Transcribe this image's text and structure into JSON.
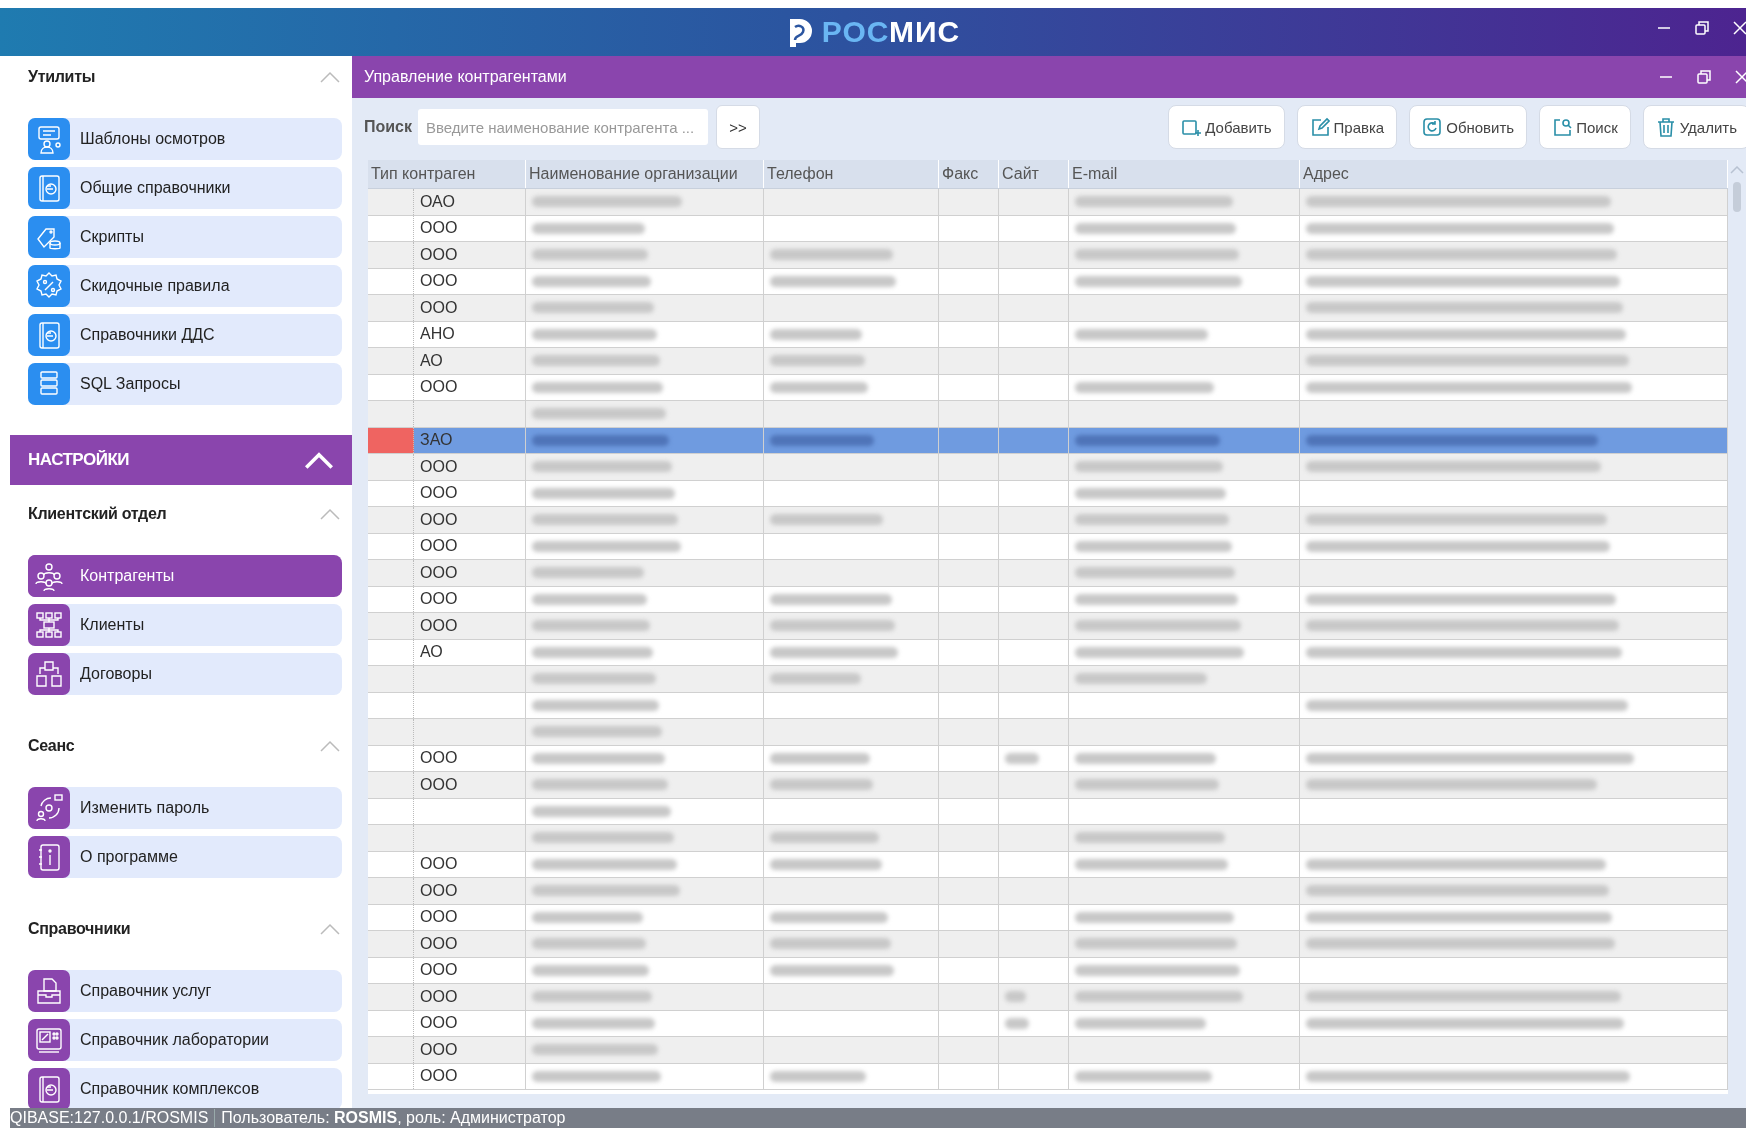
{
  "titlebar": {
    "logo_prefix": "РОС",
    "logo_suffix": "МИС"
  },
  "sidebar": {
    "sections": [
      {
        "kind": "group",
        "title": "Утилиты",
        "expanded": true,
        "color": "#2b8ef0",
        "items": [
          {
            "label": "Шаблоны осмотров",
            "selected": false
          },
          {
            "label": "Общие справочники",
            "selected": false
          },
          {
            "label": "Скрипты",
            "selected": false
          },
          {
            "label": "Скидочные правила",
            "selected": false
          },
          {
            "label": "Справочники ДДС",
            "selected": false
          },
          {
            "label": "SQL Запросы",
            "selected": false
          }
        ]
      },
      {
        "kind": "category",
        "title": "НАСТРОЙКИ",
        "expanded": true
      },
      {
        "kind": "group",
        "title": "Клиентский отдел",
        "expanded": true,
        "color": "#8a45ad",
        "items": [
          {
            "label": "Контрагенты",
            "selected": true
          },
          {
            "label": "Клиенты",
            "selected": false
          },
          {
            "label": "Договоры",
            "selected": false
          }
        ]
      },
      {
        "kind": "group",
        "title": "Сеанс",
        "expanded": true,
        "color": "#8a45ad",
        "items": [
          {
            "label": "Изменить пароль",
            "selected": false
          },
          {
            "label": "О программе",
            "selected": false
          }
        ]
      },
      {
        "kind": "group",
        "title": "Справочники",
        "expanded": true,
        "color": "#8a45ad",
        "items": [
          {
            "label": "Справочник услуг",
            "selected": false
          },
          {
            "label": "Справочник лаборатории",
            "selected": false
          },
          {
            "label": "Справочник комплексов",
            "selected": false
          }
        ]
      }
    ]
  },
  "panel": {
    "title": "Управление контрагентами",
    "search": {
      "label": "Поиск",
      "placeholder": "Введите наименование контрагента ...",
      "go": ">>"
    },
    "buttons": [
      "Добавить",
      "Правка",
      "Обновить",
      "Поиск",
      "Удалить"
    ],
    "table": {
      "columns": [
        "Тип контраген",
        "Наименование организации",
        "Телефон",
        "Факс",
        "Сайт",
        "E-mail",
        "Адрес"
      ],
      "rows": [
        {
          "type": "ОАО",
          "selected": false,
          "blurred": [
            true,
            false,
            false,
            false,
            true,
            true
          ]
        },
        {
          "type": "ООО",
          "selected": false,
          "blurred": [
            true,
            false,
            false,
            false,
            true,
            true
          ]
        },
        {
          "type": "ООО",
          "selected": false,
          "blurred": [
            true,
            true,
            false,
            false,
            true,
            true
          ]
        },
        {
          "type": "ООО",
          "selected": false,
          "blurred": [
            true,
            true,
            false,
            false,
            true,
            true
          ]
        },
        {
          "type": "ООО",
          "selected": false,
          "blurred": [
            true,
            false,
            false,
            false,
            false,
            true
          ]
        },
        {
          "type": "АНО",
          "selected": false,
          "blurred": [
            true,
            true,
            false,
            false,
            true,
            true
          ]
        },
        {
          "type": "АО",
          "selected": false,
          "blurred": [
            true,
            true,
            false,
            false,
            false,
            true
          ]
        },
        {
          "type": "ООО",
          "selected": false,
          "blurred": [
            true,
            true,
            false,
            false,
            true,
            true
          ]
        },
        {
          "selected": false,
          "blurred": [
            true,
            false,
            false,
            false,
            false,
            false
          ]
        },
        {
          "type": "ЗАО",
          "selected": true,
          "blurred": [
            true,
            true,
            false,
            false,
            true,
            true
          ]
        },
        {
          "type": "ООО",
          "selected": false,
          "blurred": [
            true,
            false,
            false,
            false,
            true,
            true
          ]
        },
        {
          "type": "ООО",
          "selected": false,
          "blurred": [
            true,
            false,
            false,
            false,
            true,
            false
          ]
        },
        {
          "type": "ООО",
          "selected": false,
          "blurred": [
            true,
            true,
            false,
            false,
            true,
            true
          ]
        },
        {
          "type": "ООО",
          "selected": false,
          "blurred": [
            true,
            false,
            false,
            false,
            true,
            true
          ]
        },
        {
          "type": "ООО",
          "selected": false,
          "blurred": [
            true,
            false,
            false,
            false,
            true,
            false
          ]
        },
        {
          "type": "ООО",
          "selected": false,
          "blurred": [
            true,
            true,
            false,
            false,
            true,
            true
          ]
        },
        {
          "type": "ООО",
          "selected": false,
          "blurred": [
            true,
            true,
            false,
            false,
            true,
            true
          ]
        },
        {
          "type": "АО",
          "selected": false,
          "blurred": [
            true,
            true,
            false,
            false,
            true,
            true
          ]
        },
        {
          "selected": false,
          "blurred": [
            true,
            true,
            false,
            false,
            true,
            false
          ]
        },
        {
          "selected": false,
          "blurred": [
            true,
            false,
            false,
            false,
            false,
            true
          ]
        },
        {
          "selected": false,
          "blurred": [
            true,
            false,
            false,
            false,
            false,
            false
          ]
        },
        {
          "type": "ООО",
          "selected": false,
          "blurred": [
            true,
            true,
            false,
            true,
            true,
            true
          ]
        },
        {
          "type": "ООО",
          "selected": false,
          "blurred": [
            true,
            true,
            false,
            false,
            true,
            true
          ]
        },
        {
          "selected": false,
          "blurred": [
            true,
            false,
            false,
            false,
            false,
            false
          ]
        },
        {
          "selected": false,
          "blurred": [
            true,
            true,
            false,
            false,
            true,
            false
          ]
        },
        {
          "type": "ООО",
          "selected": false,
          "blurred": [
            true,
            true,
            false,
            false,
            true,
            true
          ]
        },
        {
          "type": "ООО",
          "selected": false,
          "blurred": [
            true,
            false,
            false,
            false,
            false,
            true
          ]
        },
        {
          "type": "ООО",
          "selected": false,
          "blurred": [
            true,
            true,
            false,
            false,
            true,
            true
          ]
        },
        {
          "type": "ООО",
          "selected": false,
          "blurred": [
            true,
            true,
            false,
            false,
            true,
            true
          ]
        },
        {
          "type": "ООО",
          "selected": false,
          "blurred": [
            true,
            true,
            false,
            false,
            true,
            false
          ]
        },
        {
          "type": "ООО",
          "selected": false,
          "blurred": [
            true,
            false,
            false,
            true,
            true,
            true
          ]
        },
        {
          "type": "ООО",
          "selected": false,
          "blurred": [
            true,
            false,
            false,
            true,
            true,
            true
          ]
        },
        {
          "type": "ООО",
          "selected": false,
          "blurred": [
            true,
            false,
            false,
            false,
            false,
            false
          ]
        },
        {
          "type": "ООО",
          "selected": false,
          "blurred": [
            true,
            true,
            false,
            false,
            true,
            true
          ]
        }
      ]
    }
  },
  "status_bar": {
    "connection": "QIBASE:127.0.0.1/ROSMIS",
    "user": "Пользователь: **ROSMIS**, роль: Администратор"
  }
}
